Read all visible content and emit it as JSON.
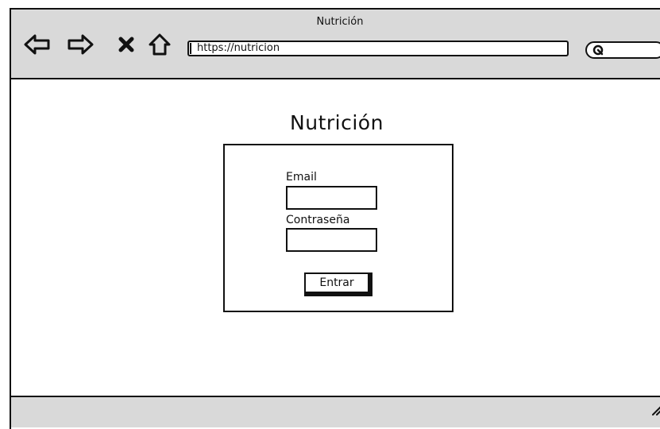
{
  "window": {
    "title": "Nutrición"
  },
  "toolbar": {
    "icons": [
      "back-arrow-icon",
      "forward-arrow-icon",
      "close-icon",
      "home-icon",
      "search-icon"
    ],
    "url": "https://nutricion"
  },
  "page": {
    "title": "Nutrición"
  },
  "login_form": {
    "email_label": "Email",
    "email_value": "",
    "password_label": "Contraseña",
    "password_value": "",
    "submit_label": "Entrar"
  }
}
